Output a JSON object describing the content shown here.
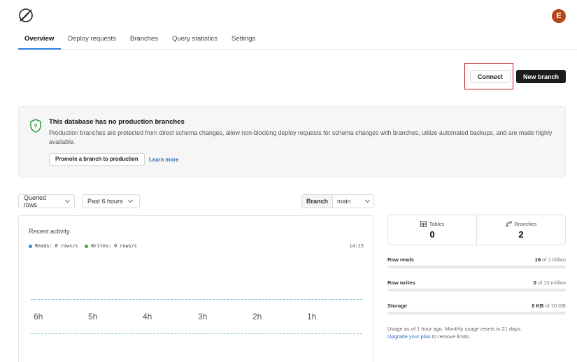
{
  "header": {
    "avatar_letter": "E"
  },
  "tabs": [
    "Overview",
    "Deploy requests",
    "Branches",
    "Query statistics",
    "Settings"
  ],
  "actions": {
    "connect": "Connect",
    "new_branch": "New branch"
  },
  "notice": {
    "title": "This database has no production branches",
    "description": "Production branches are protected from direct schema changes, allow non-blocking deploy requests for schema changes with branches, utilize automated backups, and are made highly available.",
    "promote": "Promote a branch to production",
    "learn_more": "Learn more"
  },
  "filters": {
    "metric": "Queried rows",
    "range": "Past 6 hours",
    "branch_label": "Branch",
    "branch_value": "main"
  },
  "activity": {
    "title": "Recent activity",
    "reads": "Reads: 0 rows/s",
    "writes": "Writes: 0 rows/s",
    "time": "14:15",
    "x_labels": [
      "6h",
      "5h",
      "4h",
      "3h",
      "2h",
      "1h"
    ]
  },
  "stats": {
    "tables_label": "Tables",
    "tables_value": "0",
    "branches_label": "Branches",
    "branches_value": "2"
  },
  "usage": {
    "row_reads": {
      "label": "Row reads",
      "used": "16",
      "of": " of 1 billion"
    },
    "row_writes": {
      "label": "Row writes",
      "used": "0",
      "of": " of 10 million"
    },
    "storage": {
      "label": "Storage",
      "used": "0 KB",
      "of": " of 10 GB"
    },
    "note": "Usage as of 1 hour ago. Monthly usage resets in 21 days.",
    "upgrade_link": "Upgrade your plan",
    "upgrade_rest": " to remove limits."
  },
  "colors": {
    "accent": "#2b7fd6",
    "reads": "#2b8fd6",
    "writes": "#2fae4a",
    "avatar": "#b4461a",
    "highlight": "#c0141c"
  }
}
